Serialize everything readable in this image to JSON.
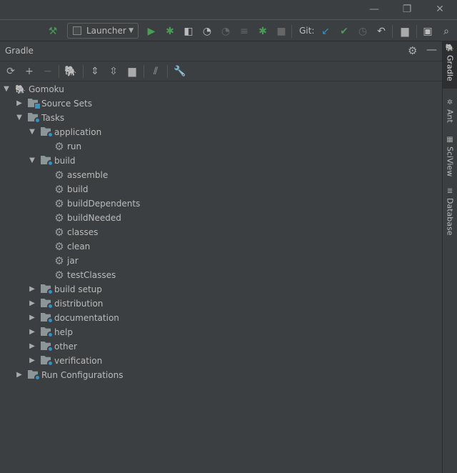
{
  "window_controls": {
    "minimize": "—",
    "restore": "❐",
    "close": "✕"
  },
  "toolbar": {
    "run_config": "Launcher",
    "git_label": "Git:"
  },
  "panel": {
    "title": "Gradle"
  },
  "tree": [
    {
      "label": "Gomoku",
      "level": 0,
      "expanded": true,
      "icon": "elephant-icon"
    },
    {
      "label": "Source Sets",
      "level": 1,
      "expanded": false,
      "icon": "source-folder-icon"
    },
    {
      "label": "Tasks",
      "level": 1,
      "expanded": true,
      "icon": "task-folder-icon"
    },
    {
      "label": "application",
      "level": 2,
      "expanded": true,
      "icon": "task-folder-icon"
    },
    {
      "label": "run",
      "level": 3,
      "icon": "gear-icon"
    },
    {
      "label": "build",
      "level": 2,
      "expanded": true,
      "icon": "task-folder-icon"
    },
    {
      "label": "assemble",
      "level": 3,
      "icon": "gear-icon"
    },
    {
      "label": "build",
      "level": 3,
      "icon": "gear-icon"
    },
    {
      "label": "buildDependents",
      "level": 3,
      "icon": "gear-icon"
    },
    {
      "label": "buildNeeded",
      "level": 3,
      "icon": "gear-icon"
    },
    {
      "label": "classes",
      "level": 3,
      "icon": "gear-icon"
    },
    {
      "label": "clean",
      "level": 3,
      "icon": "gear-icon"
    },
    {
      "label": "jar",
      "level": 3,
      "icon": "gear-icon"
    },
    {
      "label": "testClasses",
      "level": 3,
      "icon": "gear-icon"
    },
    {
      "label": "build setup",
      "level": 2,
      "expanded": false,
      "icon": "task-folder-icon"
    },
    {
      "label": "distribution",
      "level": 2,
      "expanded": false,
      "icon": "task-folder-icon"
    },
    {
      "label": "documentation",
      "level": 2,
      "expanded": false,
      "icon": "task-folder-icon"
    },
    {
      "label": "help",
      "level": 2,
      "expanded": false,
      "icon": "task-folder-icon"
    },
    {
      "label": "other",
      "level": 2,
      "expanded": false,
      "icon": "task-folder-icon"
    },
    {
      "label": "verification",
      "level": 2,
      "expanded": false,
      "icon": "task-folder-icon"
    },
    {
      "label": "Run Configurations",
      "level": 1,
      "expanded": false,
      "icon": "task-folder-icon"
    }
  ],
  "side_tabs": [
    {
      "label": "Gradle",
      "active": true
    },
    {
      "label": "Ant",
      "active": false
    },
    {
      "label": "SciView",
      "active": false
    },
    {
      "label": "Database",
      "active": false
    }
  ]
}
